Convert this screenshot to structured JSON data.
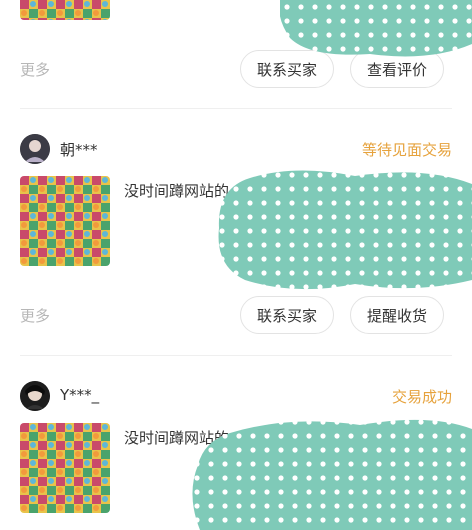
{
  "colors": {
    "accent_status": "#e6a23c",
    "redaction_fill": "#7fcab8",
    "text_primary": "#333333",
    "text_muted": "#b7b7b7",
    "border": "#e3e3e3"
  },
  "orders": [
    {
      "actions": {
        "more_label": "更多",
        "buttons": [
          "联系买家",
          "查看评价"
        ]
      }
    },
    {
      "buyer_name": "朝***",
      "status": "等待见面交易",
      "item_title": "没时间蹲网站的",
      "avatar_icon": "user-avatar-icon",
      "actions": {
        "more_label": "更多",
        "buttons": [
          "联系买家",
          "提醒收货"
        ]
      }
    },
    {
      "buyer_name": "Y***_",
      "status": "交易成功",
      "item_title": "没时间蹲网站的，网速慢的可",
      "avatar_icon": "user-avatar-icon"
    }
  ]
}
